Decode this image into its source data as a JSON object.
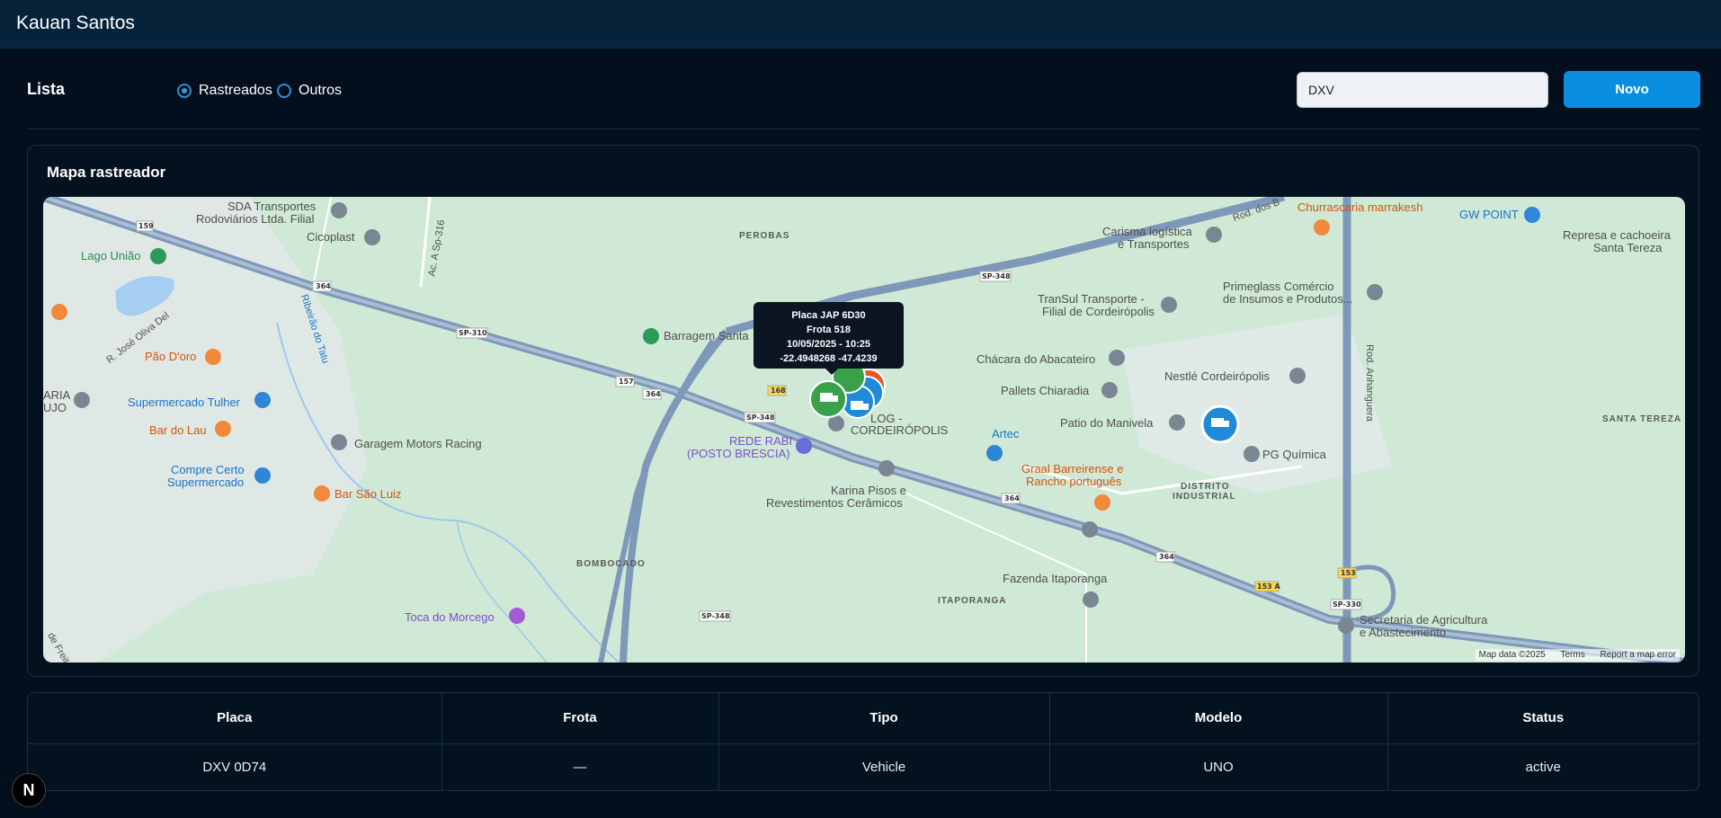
{
  "header": {
    "user_name": "Kauan Santos"
  },
  "toolbar": {
    "title": "Lista",
    "radios": [
      {
        "label": "Rastreados",
        "checked": true
      },
      {
        "label": "Outros",
        "checked": false
      }
    ],
    "search_value": "DXV",
    "new_button": "Novo"
  },
  "map": {
    "title": "Mapa rastreador",
    "tooltip": {
      "plate": "Placa JAP 6D30",
      "fleet": "Frota 518",
      "datetime": "10/05/2025 - 10:25",
      "coords": "-22.4948268 -47.4239"
    },
    "pois": [
      "SDA Transportes",
      "Rodoviários Ltda. Filial",
      "Cicoplast",
      "Lago União",
      "Pão D'oro",
      "Supermercado Tulher",
      "Bar do Lau",
      "Garagem Motors Racing",
      "Compre Certo",
      "Supermercado",
      "Bar São Luiz",
      "Toca do Morcego",
      "Barragem Santa",
      "REDE RABI",
      "(POSTO BRESCIA)",
      "LOG -",
      "CORDEIRÓPOLIS",
      "Karina Pisos e",
      "Revestimentos Cerâmicos",
      "Artec",
      "Graal Barreirense e",
      "Rancho português",
      "Fazenda Itaporanga",
      "Chácara do Abacateiro",
      "Pallets Chiaradia",
      "Patio do Manivela",
      "Nestlé Cordeirópolis",
      "PG Química",
      "TranSul Transporte -",
      "Filial de Cordeirópolis",
      "Carisma logística",
      "e Transportes",
      "Churrascaria marrakesh",
      "GW POINT",
      "Primeglass Comércio",
      "de Insumos e Produtos...",
      "Represa e cachoeira",
      "Santa Tereza",
      "Secretaria de Agricultura",
      "e Abastecimento",
      "ARIA",
      "UJO",
      "R. José Oliva Del",
      "Ribeirão do Tatu",
      "Ac. A Sp-316",
      "Rod. dos B",
      "Rod. Anhanguera",
      "de Freit"
    ],
    "areas": [
      "PEROBAS",
      "BOMBOCADO",
      "ITAPORANGA",
      "SANTA TEREZA",
      "DISTRITO",
      "INDUSTRIAL"
    ],
    "road_shields": [
      "159",
      "364",
      "SP-310",
      "157",
      "364",
      "168",
      "SP-348",
      "SP-348",
      "364",
      "364",
      "153",
      "153 A",
      "SP-330",
      "SP-348"
    ],
    "footer": {
      "attribution": "Map data ©2025",
      "terms": "Terms",
      "report": "Report a map error"
    }
  },
  "table": {
    "headers": [
      "Placa",
      "Frota",
      "Tipo",
      "Modelo",
      "Status"
    ],
    "rows": [
      [
        "DXV 0D74",
        "—",
        "Vehicle",
        "UNO",
        "active"
      ]
    ]
  },
  "badge": {
    "label": "N"
  },
  "colors": {
    "accent": "#0a8ee0",
    "background": "#030f1d",
    "map_land": "#cfe9d6",
    "road": "#7d98b8"
  }
}
